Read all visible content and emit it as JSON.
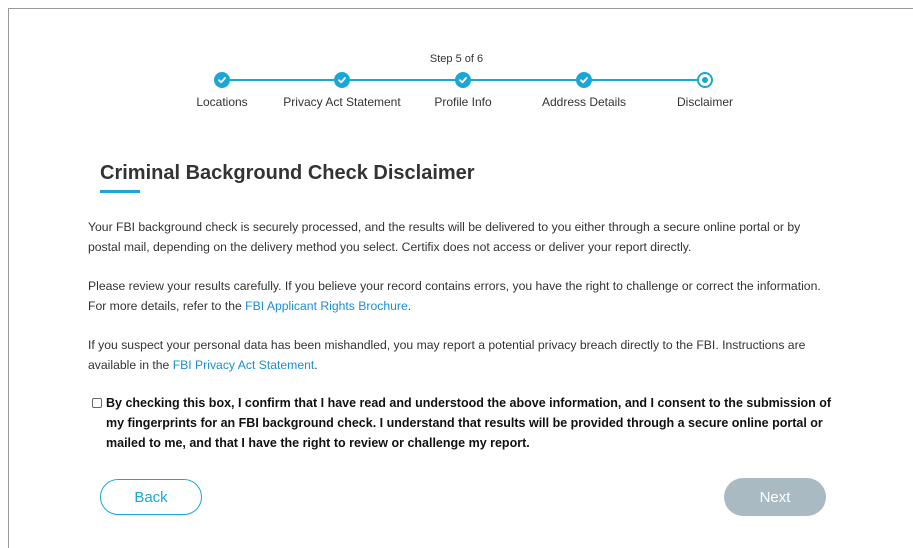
{
  "stepper": {
    "step_count": "Step 5 of 6",
    "steps": [
      {
        "label": "Locations",
        "state": "complete"
      },
      {
        "label": "Privacy Act Statement",
        "state": "complete"
      },
      {
        "label": "Profile Info",
        "state": "complete"
      },
      {
        "label": "Address Details",
        "state": "complete"
      },
      {
        "label": "Disclaimer",
        "state": "current"
      }
    ]
  },
  "content": {
    "title": "Criminal Background Check Disclaimer",
    "para1": "Your FBI background check is securely processed, and the results will be delivered to you either through a secure online portal or by postal mail, depending on the delivery method you select. Certifix does not access or deliver your report directly.",
    "para2_text": "Please review your results carefully. If you believe your record contains errors, you have the right to challenge or correct the information. For more details, refer to the ",
    "para2_link": "FBI Applicant Rights Brochure",
    "para2_end": ".",
    "para3_text": "If you suspect your personal data has been mishandled, you may report a potential privacy breach directly to the FBI. Instructions are available in the ",
    "para3_link": "FBI Privacy Act Statement",
    "para3_end": ".",
    "consent_text": "By checking this box, I confirm that I have read and understood the above information, and I consent to the submission of my fingerprints for an FBI background check. I understand that results will be provided through a secure online portal or mailed to me, and that I have the right to review or challenge my report.",
    "consent_checked": false
  },
  "buttons": {
    "back": "Back",
    "next": "Next"
  },
  "colors": {
    "accent": "#1aa7d8",
    "link": "#1a8fd0",
    "next_disabled": "#a9bac2"
  },
  "icons": {
    "complete": "check-icon",
    "current": "radio-dot-icon"
  }
}
